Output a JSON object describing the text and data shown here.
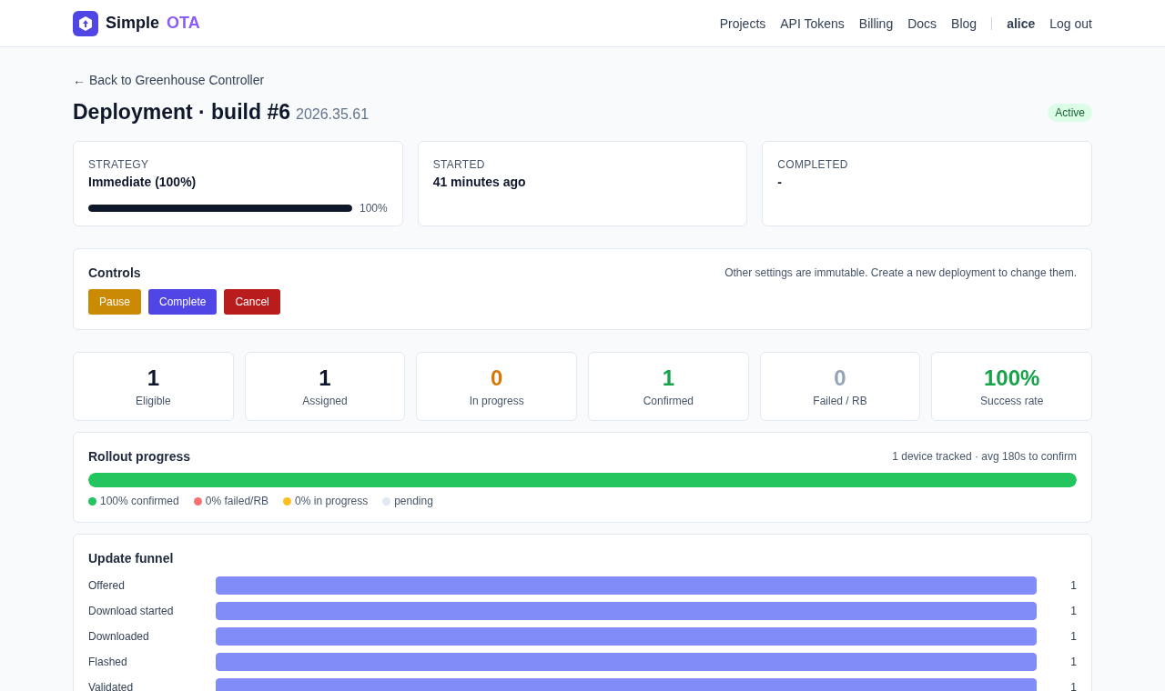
{
  "brand": {
    "name": "Simple",
    "accent": "OTA"
  },
  "nav": {
    "links": [
      "Projects",
      "API Tokens",
      "Billing",
      "Docs",
      "Blog"
    ],
    "user": "alice",
    "logout": "Log out"
  },
  "back_link": "← Back to Greenhouse Controller",
  "title": "Deployment · build #6",
  "version": "2026.35.61",
  "status": "Active",
  "info_cards": [
    {
      "label": "STRATEGY",
      "value": "Immediate (100%)",
      "kind": "progress",
      "level": 1,
      "reading": "100%"
    },
    {
      "label": "STARTED",
      "value": "41 minutes ago",
      "kind": "text"
    },
    {
      "label": "COMPLETED",
      "value": "-",
      "kind": "text"
    }
  ],
  "controls": {
    "title": "Controls",
    "note": "Other settings are immutable. Create a new deployment to change them.",
    "buttons": [
      {
        "label": "Pause",
        "color": "#ca8a04"
      },
      {
        "label": "Complete",
        "color": "#4f46e5"
      },
      {
        "label": "Cancel",
        "color": "#b91c1c"
      }
    ]
  },
  "stats": [
    {
      "value": "1",
      "label": "Eligible",
      "color": "#0f172a"
    },
    {
      "value": "1",
      "label": "Assigned",
      "color": "#0f172a"
    },
    {
      "value": "0",
      "label": "In progress",
      "color": "#d97706"
    },
    {
      "value": "1",
      "label": "Confirmed",
      "color": "#16a34a"
    },
    {
      "value": "0",
      "label": "Failed / RB",
      "color": "#94a3b8"
    },
    {
      "value": "100%",
      "label": "Success rate",
      "color": "#16a34a"
    }
  ],
  "rollout": {
    "title": "Rollout progress",
    "summary": "1 device tracked · avg 180s to confirm",
    "level": 1,
    "legend": [
      {
        "label": "100% confirmed",
        "color": "#22c55e"
      },
      {
        "label": "0% failed/RB",
        "color": "#f87171"
      },
      {
        "label": "0% in progress",
        "color": "#fbbf24"
      },
      {
        "label": "pending",
        "color": "#e2e8f0"
      }
    ]
  },
  "funnel": {
    "title": "Update funnel",
    "rows": [
      {
        "label": "Offered",
        "level": 1,
        "count": "1"
      },
      {
        "label": "Download started",
        "level": 1,
        "count": "1"
      },
      {
        "label": "Downloaded",
        "level": 1,
        "count": "1"
      },
      {
        "label": "Flashed",
        "level": 1,
        "count": "1"
      },
      {
        "label": "Validated",
        "level": 1,
        "count": "1"
      }
    ]
  }
}
